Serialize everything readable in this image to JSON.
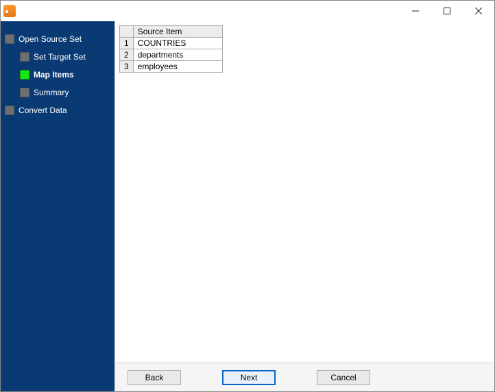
{
  "window": {
    "title": ""
  },
  "sidebar": {
    "items": [
      {
        "label": "Open Source Set",
        "level": 0,
        "active": false
      },
      {
        "label": "Set Target Set",
        "level": 1,
        "active": false
      },
      {
        "label": "Map Items",
        "level": 1,
        "active": true
      },
      {
        "label": "Summary",
        "level": 1,
        "active": false
      },
      {
        "label": "Convert Data",
        "level": 0,
        "active": false
      }
    ]
  },
  "table": {
    "header": "Source Item",
    "rows": [
      {
        "n": "1",
        "v": "COUNTRIES"
      },
      {
        "n": "2",
        "v": "departments"
      },
      {
        "n": "3",
        "v": "employees"
      }
    ]
  },
  "buttons": {
    "back": "Back",
    "next": "Next",
    "cancel": "Cancel"
  }
}
